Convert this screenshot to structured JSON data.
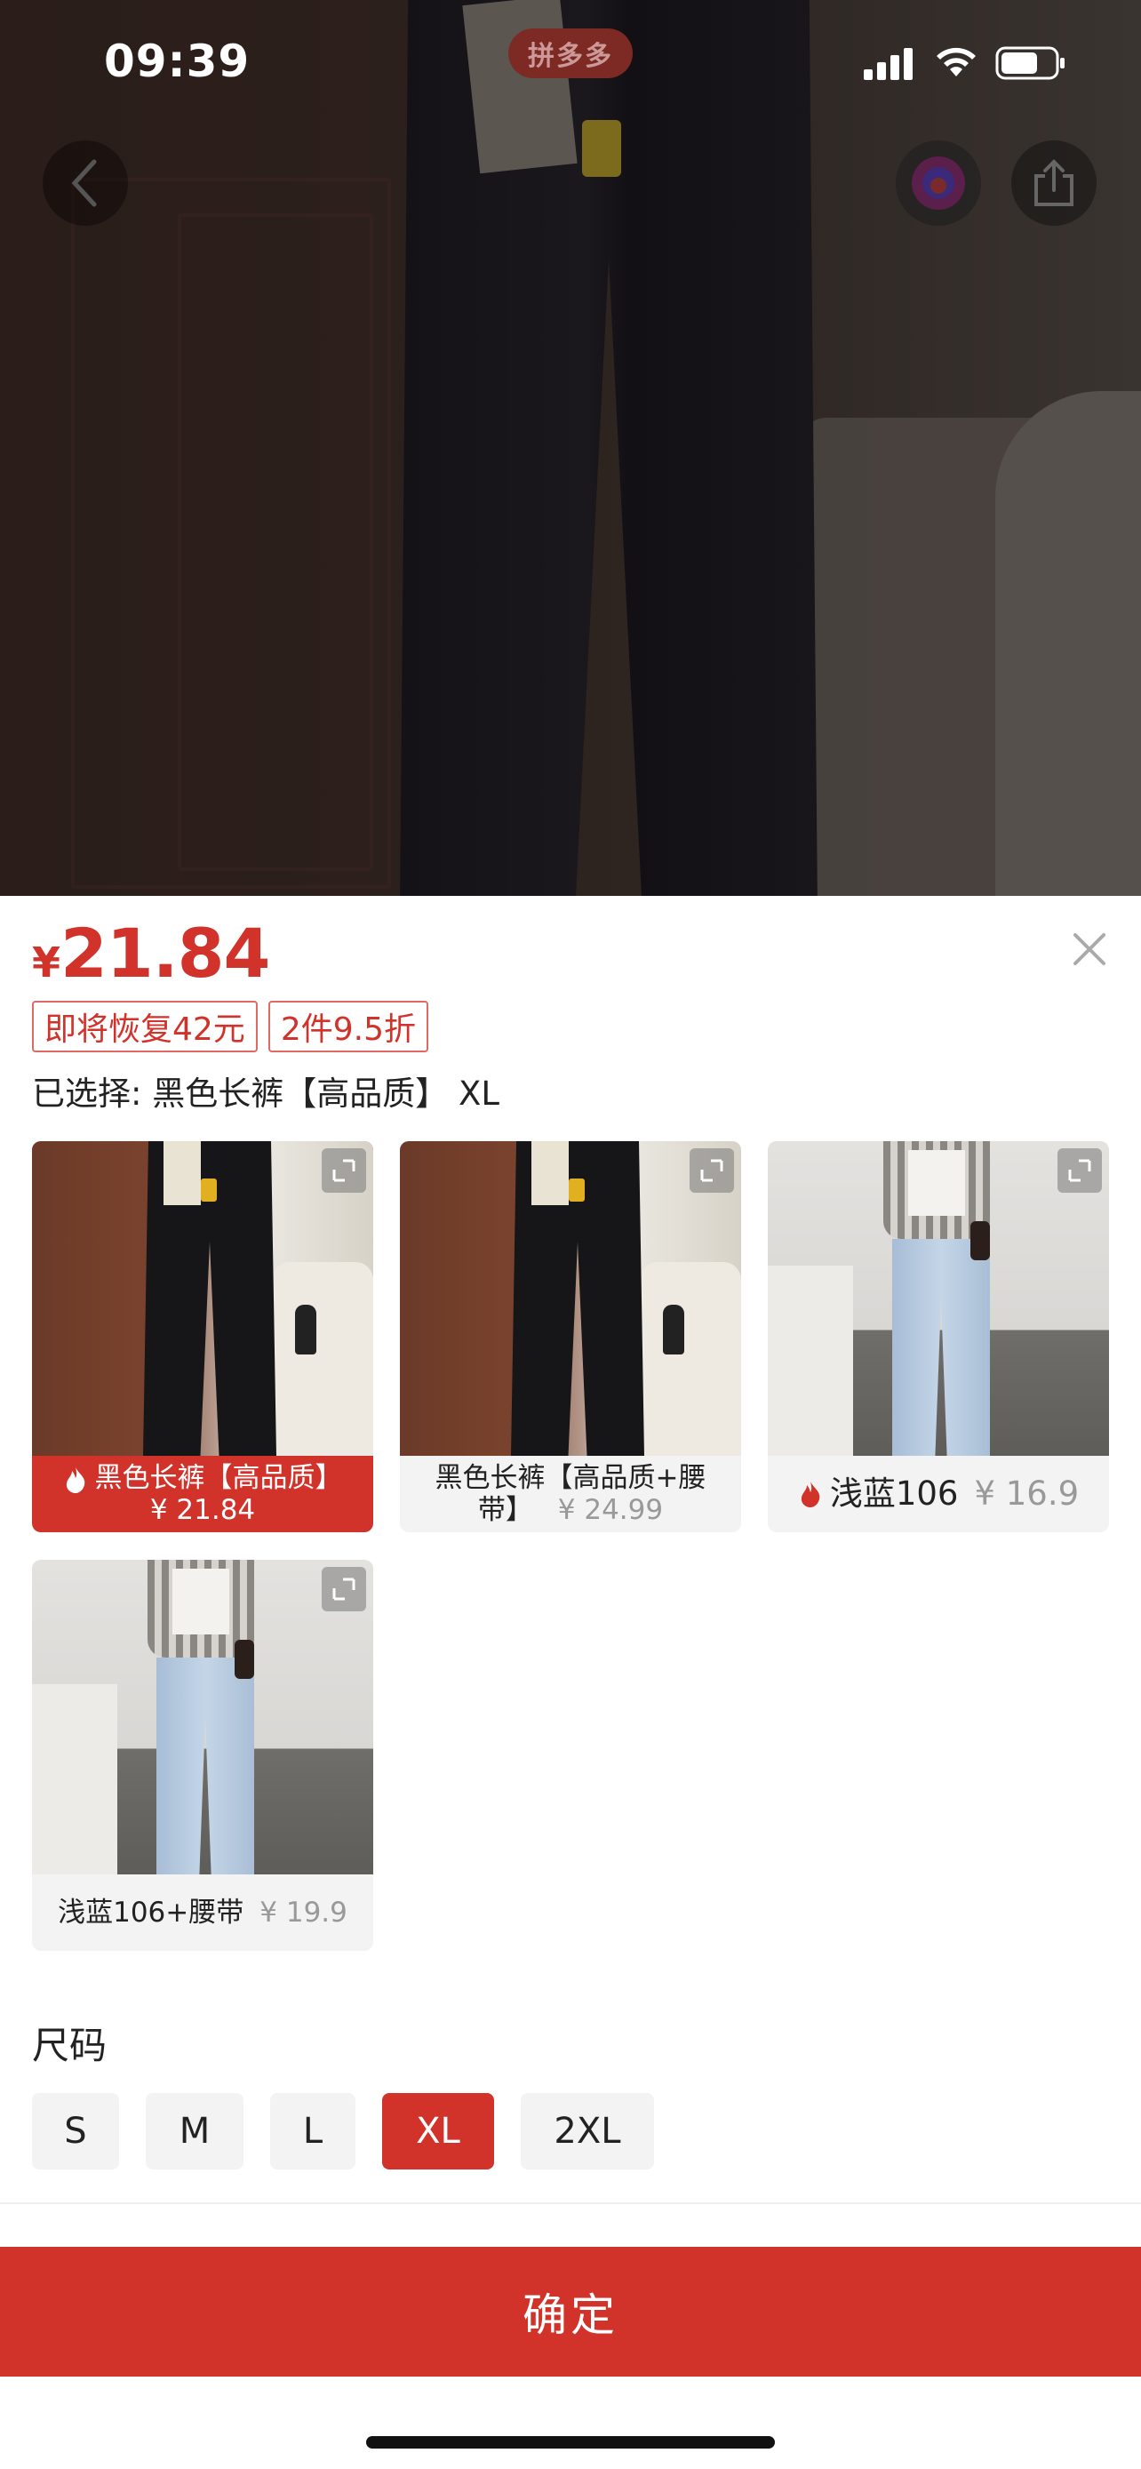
{
  "status_bar": {
    "time": "09:39"
  },
  "hero": {
    "badge_text": "拼多多"
  },
  "sheet": {
    "price_currency": "¥",
    "price_value": "21.84",
    "tags": [
      "即将恢复42元",
      "2件9.5折"
    ],
    "selected_text": "已选择: 黑色长裤【高品质】 XL",
    "variants": [
      {
        "name": "黑色长裤【高品质】",
        "price": "¥ 21.84",
        "hot": true,
        "selected": true
      },
      {
        "name": "黑色长裤【高品质+腰带】",
        "price": "¥ 24.99",
        "hot": false,
        "selected": false
      },
      {
        "name": "浅蓝106",
        "price": "¥ 16.9",
        "hot": true,
        "selected": false
      },
      {
        "name": "浅蓝106+腰带",
        "price": "¥ 19.9",
        "hot": false,
        "selected": false
      }
    ],
    "size_title": "尺码",
    "sizes": [
      "S",
      "M",
      "L",
      "XL",
      "2XL"
    ],
    "selected_size": "XL",
    "confirm_label": "确定"
  },
  "colors": {
    "accent": "#d1322a"
  }
}
